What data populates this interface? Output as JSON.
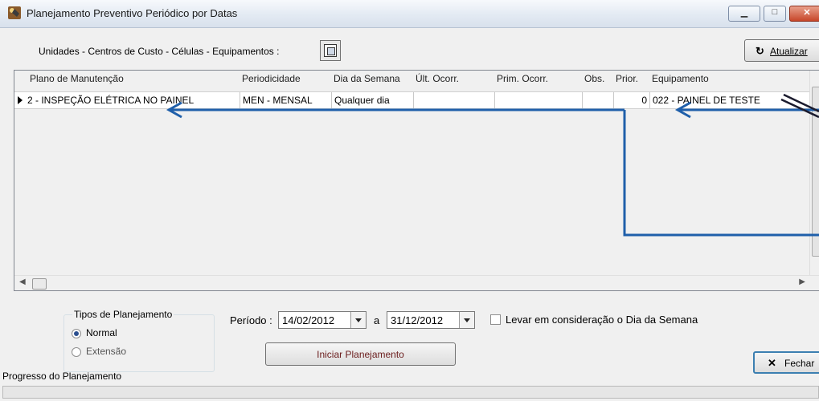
{
  "window": {
    "title": "Planejamento Preventivo Periódico por Datas",
    "buttons": {
      "minimize": "▁",
      "maximize": "□",
      "close": "✕"
    }
  },
  "toolbar": {
    "hierarchy_label": "Unidades - Centros de Custo - Células - Equipamentos :",
    "hierarchy_icon": "tree-select-icon",
    "refresh_icon": "↻",
    "refresh_label": "Atualizar"
  },
  "grid": {
    "columns": [
      "Plano de Manutenção",
      "Periodicidade",
      "Dia da Semana",
      "Últ. Ocorr.",
      "Prim. Ocorr.",
      "Obs.",
      "Prior.",
      "Equipamento"
    ],
    "rows": [
      {
        "plano": "2 - INSPEÇÃO ELÉTRICA NO PAINEL",
        "periodicidade": "MEN - MENSAL",
        "dia_semana": "Qualquer dia",
        "ult_ocorr": "",
        "prim_ocorr": "",
        "obs": "",
        "prior": "0",
        "equipamento": "022 - PAINEL DE TESTE"
      }
    ]
  },
  "planning_types": {
    "title": "Tipos de Planejamento",
    "options": [
      "Normal",
      "Extensão"
    ],
    "selected": "Normal"
  },
  "period": {
    "label": "Período :",
    "from": "14/02/2012",
    "separator": "a",
    "to": "31/12/2012",
    "weekday_checkbox_label": "Levar em consideração o Dia da Semana",
    "weekday_checked": false
  },
  "actions": {
    "start_label": "Iniciar Planejamento",
    "close_icon": "✕",
    "close_label": "Fechar"
  },
  "progress": {
    "label": "Progresso do Planejamento",
    "value": 0
  },
  "colors": {
    "annotation_arrow": "#1f5faa",
    "progress_fill": "#3c9b3c"
  }
}
